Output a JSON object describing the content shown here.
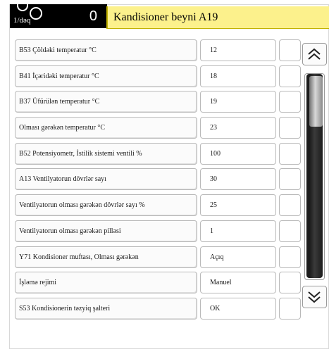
{
  "header": {
    "rpm_unit": "1/dəq",
    "counter": "0",
    "title": "Kandisioner beyni A19"
  },
  "rows": [
    {
      "label": "B53 Çöldəki temperatur °C",
      "value": "12"
    },
    {
      "label": "B41 İçəridəki temperatur °C",
      "value": "18"
    },
    {
      "label": "B37 Üfürülən temperatur °C",
      "value": "19"
    },
    {
      "label": "Olması gərəkən temperatur °C",
      "value": "23"
    },
    {
      "label": "B52 Potensiyometr, İstilik sistemi ventili %",
      "value": "100"
    },
    {
      "label": "A13 Ventilyatorun dövrlər sayı",
      "value": "30"
    },
    {
      "label": "Ventilyatorun olması gərəkən dövrlər sayı %",
      "value": "25"
    },
    {
      "label": "Ventilyatorun olması gərəkən pilləsi",
      "value": "1"
    },
    {
      "label": "Y71 Kondisioner muftası, Olması gərəkən",
      "value": "Açıq"
    },
    {
      "label": "İşləmə rejimi",
      "value": "Manuel"
    },
    {
      "label": "S53 Kondisionerin təzyiq şalteri",
      "value": "OK"
    }
  ],
  "scrollbar": {
    "up_icon": "double-chevron-up-icon",
    "down_icon": "double-chevron-down-icon"
  },
  "colors": {
    "title_bar": "#fcf18c",
    "header_dark": "#000000"
  }
}
